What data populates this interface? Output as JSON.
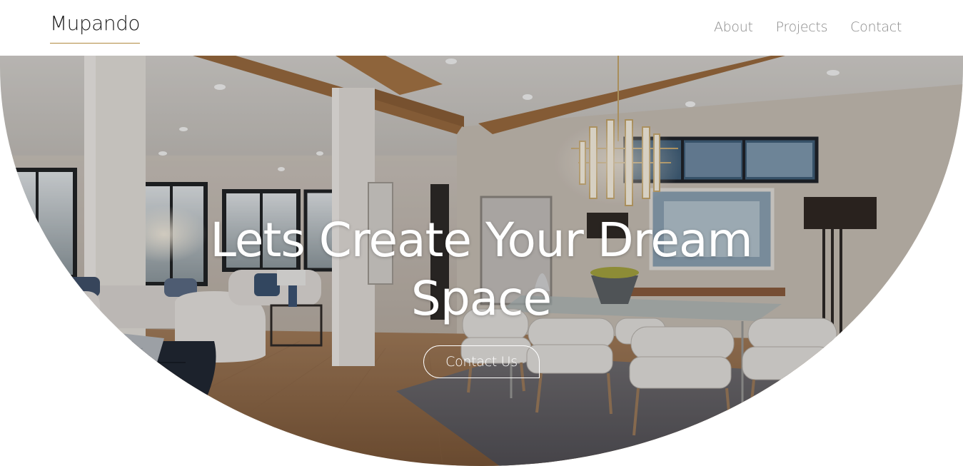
{
  "header": {
    "logo": "Mupando",
    "nav": [
      {
        "label": "About"
      },
      {
        "label": "Projects"
      },
      {
        "label": "Contact"
      }
    ]
  },
  "hero": {
    "title": "Lets Create Your Dream Space",
    "cta_label": "Contact Us",
    "background_image": "interior-dining-room-photo"
  },
  "colors": {
    "logo_underline": "#b0893f",
    "nav_text": "#8a8a8a",
    "hero_text": "#ffffff"
  }
}
